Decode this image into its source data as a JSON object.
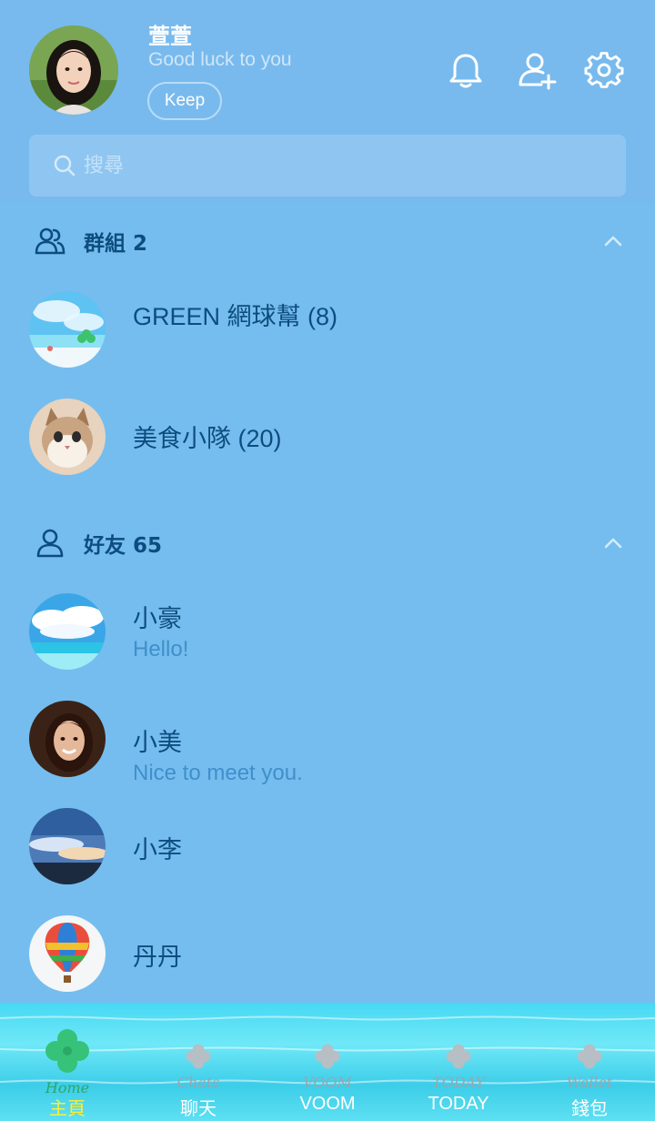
{
  "profile": {
    "name": "萱萱",
    "status": "Good luck to you",
    "keep_label": "Keep"
  },
  "header_icons": [
    "bell-icon",
    "add-friend-icon",
    "gear-icon"
  ],
  "search": {
    "placeholder": "搜尋"
  },
  "groups": {
    "title": "群組 2",
    "items": [
      {
        "name": "GREEN 網球幫 (8)"
      },
      {
        "name": "美食小隊 (20)"
      }
    ]
  },
  "friends": {
    "title": "好友 65",
    "items": [
      {
        "name": "小豪",
        "message": "Hello!"
      },
      {
        "name": "小美",
        "message": "Nice to meet you."
      },
      {
        "name": "小李",
        "message": ""
      },
      {
        "name": "丹丹",
        "message": ""
      }
    ]
  },
  "nav": {
    "items": [
      {
        "script": "Home",
        "label": "主頁",
        "active": true
      },
      {
        "script": "Chats",
        "label": "聊天",
        "active": false
      },
      {
        "script": "VOOM",
        "label": "VOOM",
        "active": false
      },
      {
        "script": "TODAY",
        "label": "TODAY",
        "active": false
      },
      {
        "script": "Wallet",
        "label": "錢包",
        "active": false
      }
    ]
  },
  "colors": {
    "background": "#75bdee",
    "header": "#78baed",
    "text_dark": "#0d4d7e",
    "text_sub": "#3f8fcc",
    "nav_active": "#ffee33"
  }
}
